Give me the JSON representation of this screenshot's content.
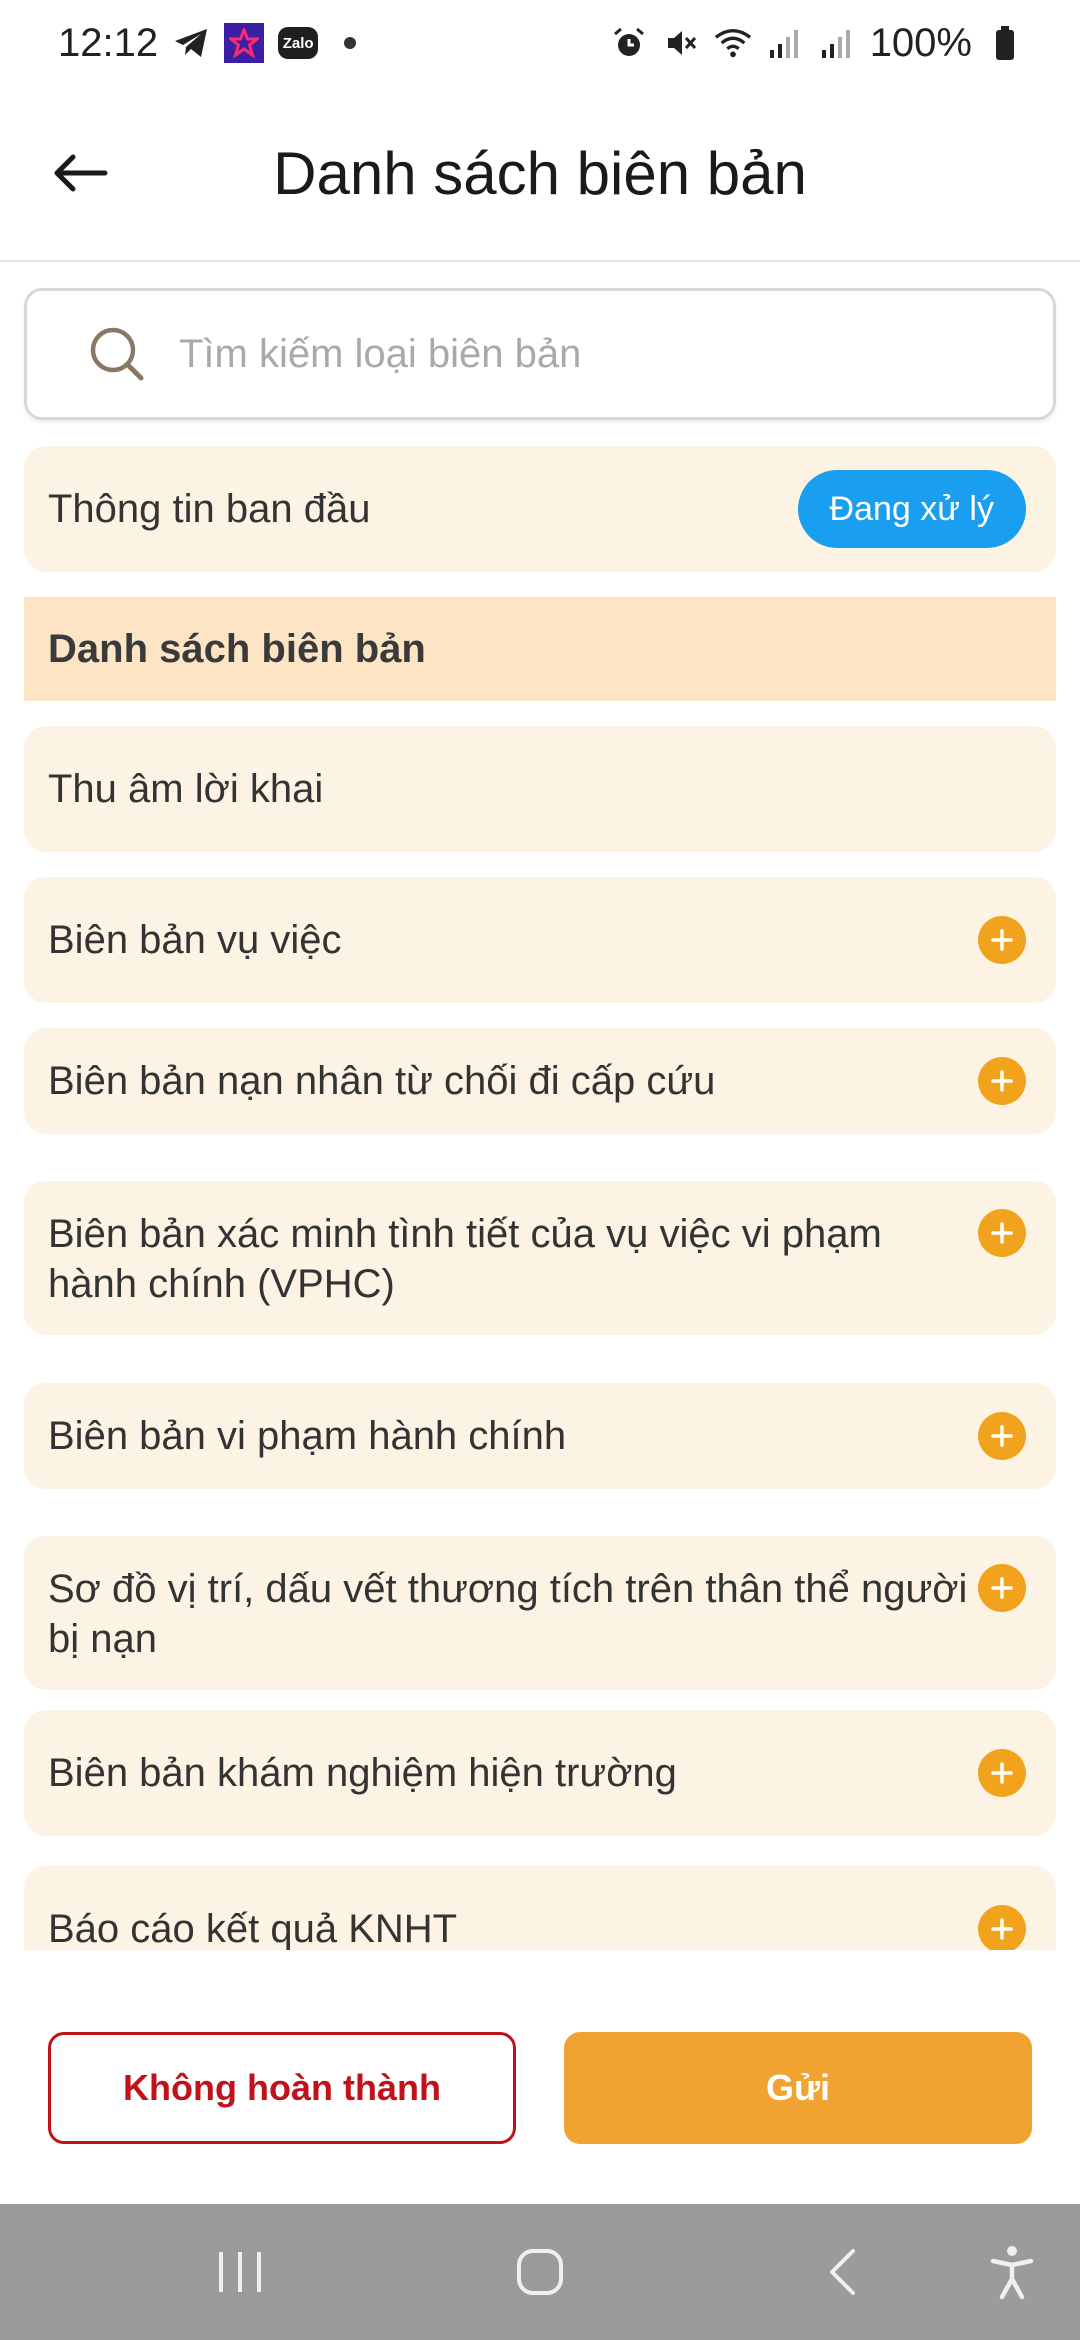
{
  "status_bar": {
    "time": "12:12",
    "zalo": "Zalo",
    "battery": "100%"
  },
  "header": {
    "title": "Danh sách biên bản"
  },
  "search": {
    "placeholder": "Tìm kiếm loại biên bản"
  },
  "initial_info": {
    "label": "Thông tin ban đầu",
    "status": "Đang xử lý"
  },
  "section": {
    "title": "Danh sách biên bản"
  },
  "records": [
    {
      "label": "Thu âm lời khai"
    },
    {
      "label": "Biên bản vụ việc"
    },
    {
      "label": "Biên bản nạn nhân từ chối đi cấp cứu"
    },
    {
      "label": "Biên bản xác minh tình tiết của vụ việc vi phạm hành chính (VPHC)"
    },
    {
      "label": "Biên bản vi phạm hành chính"
    },
    {
      "label": "Sơ đồ vị trí, dấu vết thương tích trên thân thể người bị nạn"
    },
    {
      "label": "Biên bản khám nghiệm hiện trường"
    },
    {
      "label": "Báo cáo kết quả KNHT"
    }
  ],
  "footer": {
    "incomplete_label": "Không hoàn thành",
    "send_label": "Gửi"
  },
  "colors": {
    "accent_orange": "#f2a31d",
    "status_blue": "#1a9ff0",
    "danger_red": "#c0121b",
    "card_bg": "#fdf3e5"
  }
}
